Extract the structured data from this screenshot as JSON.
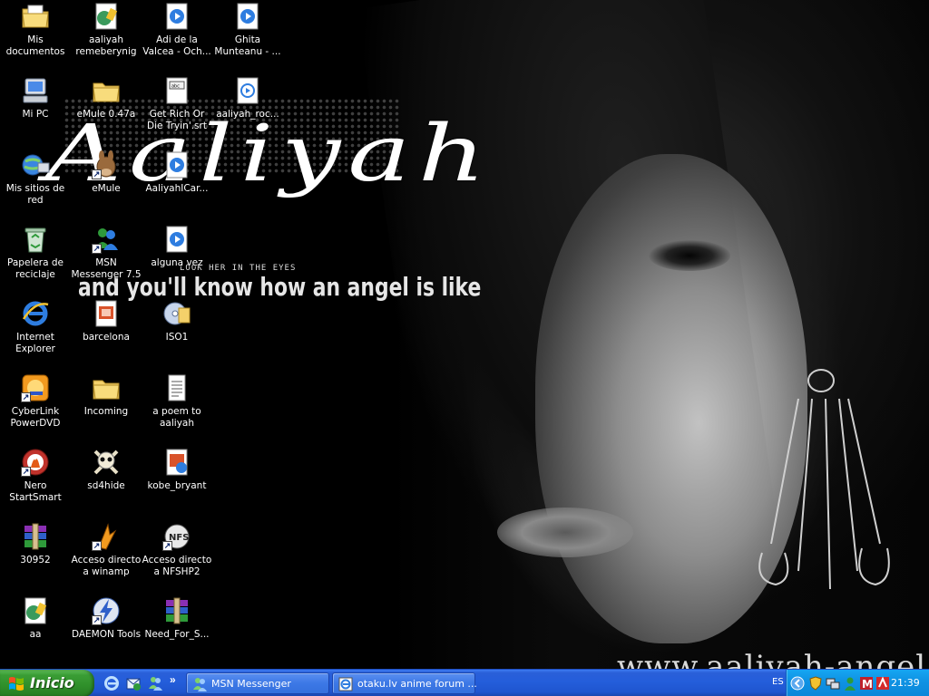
{
  "wallpaper": {
    "logo_text": "Aaliyah",
    "tagline_small": "LOOK HER IN THE EYES",
    "tagline_big": "and you'll know how an angel is like",
    "url_text": "www.aaliyah-angel.tk"
  },
  "desktop_icons": [
    {
      "label": "Mis documentos",
      "icon": "my-documents-icon"
    },
    {
      "label": "aaliyah remeberynig",
      "icon": "video-file-icon"
    },
    {
      "label": "Adi de la Valcea - Och...",
      "icon": "media-player-file-icon"
    },
    {
      "label": "Ghita Munteanu - ...",
      "icon": "media-player-file-icon"
    },
    {
      "label": "Mi PC",
      "icon": "my-computer-icon"
    },
    {
      "label": "eMule 0.47a",
      "icon": "folder-icon"
    },
    {
      "label": "Get Rich Or Die Tryin'.srt",
      "icon": "srt-file-icon"
    },
    {
      "label": "aaliyah_roc...",
      "icon": "media-file-icon"
    },
    {
      "label": "Mis sitios de red",
      "icon": "network-places-icon"
    },
    {
      "label": "eMule",
      "icon": "emule-mule-icon"
    },
    {
      "label": "AaliyahICar...",
      "icon": "media-player-file-icon"
    },
    {
      "label": "Papelera de reciclaje",
      "icon": "recycle-bin-icon"
    },
    {
      "label": "MSN Messenger 7.5",
      "icon": "msn-messenger-icon"
    },
    {
      "label": "alguna vez",
      "icon": "media-player-file-icon"
    },
    {
      "label": "Internet Explorer",
      "icon": "internet-explorer-icon"
    },
    {
      "label": "barcelona",
      "icon": "powerpoint-file-icon"
    },
    {
      "label": "ISO1",
      "icon": "disc-image-icon"
    },
    {
      "label": "CyberLink PowerDVD",
      "icon": "powerdvd-icon"
    },
    {
      "label": "Incoming",
      "icon": "folder-icon"
    },
    {
      "label": "a poem to aaliyah",
      "icon": "text-document-icon"
    },
    {
      "label": "Nero StartSmart",
      "icon": "nero-icon"
    },
    {
      "label": "sd4hide",
      "icon": "skull-crossbones-icon"
    },
    {
      "label": "kobe_bryant",
      "icon": "image-file-icon"
    },
    {
      "label": "30952",
      "icon": "winrar-archive-icon"
    },
    {
      "label": "Acceso directo a winamp",
      "icon": "winamp-icon"
    },
    {
      "label": "Acceso directo a NFSHP2",
      "icon": "nfs-icon"
    },
    {
      "label": "aa",
      "icon": "video-file-icon"
    },
    {
      "label": "DAEMON Tools",
      "icon": "daemon-tools-icon"
    },
    {
      "label": "Need_For_S...",
      "icon": "winrar-archive-icon"
    }
  ],
  "taskbar": {
    "start_label": "Inicio",
    "quick_launch": [
      "internet-explorer-icon",
      "outlook-express-icon",
      "msn-messenger-icon"
    ],
    "more_label": "»",
    "tasks": [
      {
        "label": "MSN Messenger",
        "icon": "msn-messenger-icon"
      },
      {
        "label": "otaku.lv anime forum ...",
        "icon": "internet-explorer-icon"
      }
    ],
    "language": "ES",
    "tray_icons": [
      "chevron-left-icon",
      "security-shield-icon",
      "network-icon",
      "msn-buddy-icon",
      "mcafee-icon",
      "antivirus-icon"
    ],
    "clock": "21:39"
  }
}
